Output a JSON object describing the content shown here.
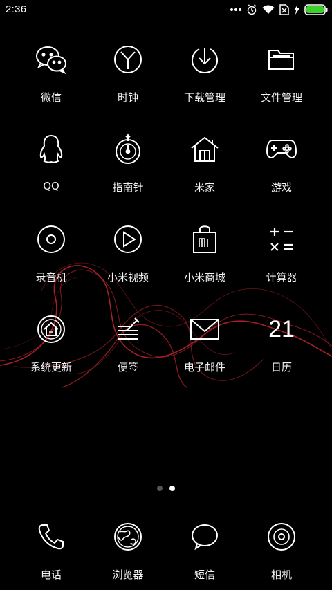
{
  "status_bar": {
    "time": "2:36",
    "icons": [
      "more-dots-icon",
      "alarm-icon",
      "wifi-icon",
      "no-sim-icon",
      "charging-icon",
      "battery-icon"
    ],
    "battery_color": "#3ecf2a"
  },
  "apps": [
    {
      "label": "微信",
      "icon": "wechat-icon"
    },
    {
      "label": "时钟",
      "icon": "clock-icon"
    },
    {
      "label": "下载管理",
      "icon": "download-icon"
    },
    {
      "label": "文件管理",
      "icon": "folder-icon"
    },
    {
      "label": "QQ",
      "icon": "penguin-icon"
    },
    {
      "label": "指南针",
      "icon": "compass-icon"
    },
    {
      "label": "米家",
      "icon": "home-icon"
    },
    {
      "label": "游戏",
      "icon": "gamepad-icon"
    },
    {
      "label": "录音机",
      "icon": "recorder-icon"
    },
    {
      "label": "小米视频",
      "icon": "play-icon"
    },
    {
      "label": "小米商城",
      "icon": "shopping-bag-icon"
    },
    {
      "label": "计算器",
      "icon": "calculator-icon"
    },
    {
      "label": "系统更新",
      "icon": "update-icon"
    },
    {
      "label": "便签",
      "icon": "notes-icon"
    },
    {
      "label": "电子邮件",
      "icon": "mail-icon"
    },
    {
      "label": "日历",
      "icon": "calendar-icon",
      "day": "21"
    }
  ],
  "pager": {
    "pages": 2,
    "current": 2
  },
  "dock": [
    {
      "label": "电话",
      "icon": "phone-icon"
    },
    {
      "label": "浏览器",
      "icon": "globe-icon"
    },
    {
      "label": "短信",
      "icon": "message-icon"
    },
    {
      "label": "相机",
      "icon": "camera-icon"
    }
  ],
  "wallpaper": {
    "accent": "#b8242c"
  }
}
